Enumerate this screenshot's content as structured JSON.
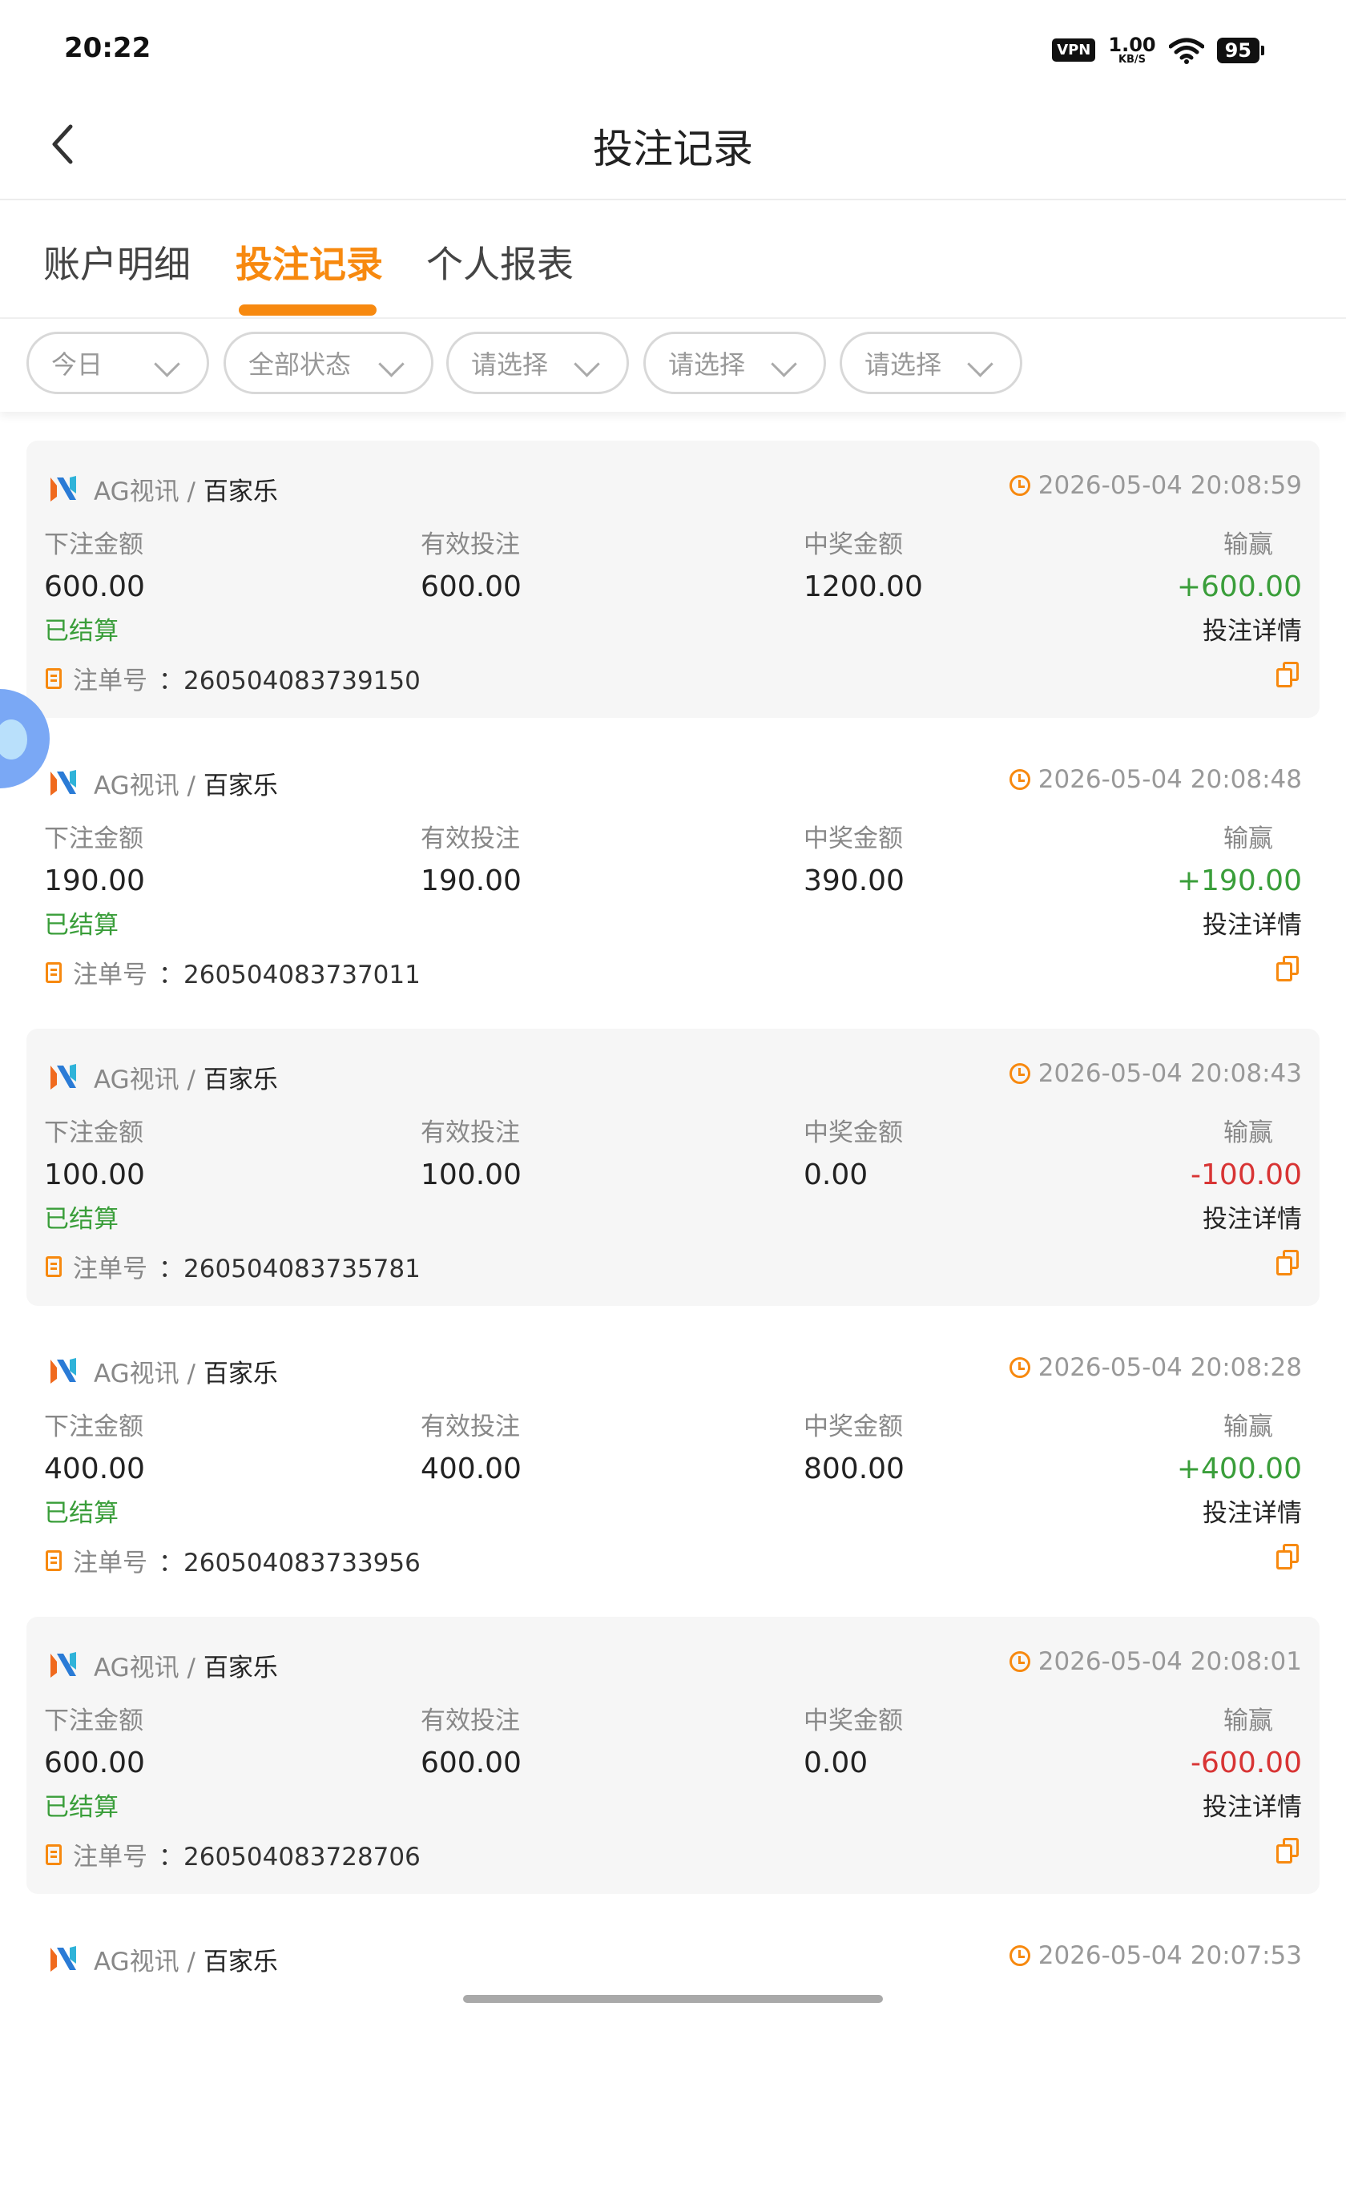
{
  "status_bar": {
    "time": "20:22",
    "vpn": "VPN",
    "speed_value": "1.00",
    "speed_unit": "KB/S",
    "battery": "95"
  },
  "header": {
    "title": "投注记录",
    "back_icon": "chevron-left-icon"
  },
  "tabs": [
    {
      "label": "账户明细",
      "active": false
    },
    {
      "label": "投注记录",
      "active": true
    },
    {
      "label": "个人报表",
      "active": false
    }
  ],
  "filters": [
    {
      "label": "今日"
    },
    {
      "label": "全部状态"
    },
    {
      "label": "请选择"
    },
    {
      "label": "请选择"
    },
    {
      "label": "请选择"
    }
  ],
  "labels": {
    "bet_amount": "下注金额",
    "valid_bet": "有效投注",
    "win_amount": "中奖金额",
    "win_loss": "输赢",
    "detail": "投注详情",
    "order_no": "注单号",
    "order_sep": "："
  },
  "colors": {
    "accent": "#f7890f",
    "positive": "#3a9e3a",
    "negative": "#d83434"
  },
  "records": [
    {
      "provider": "AG视讯",
      "sep": " / ",
      "game": "百家乐",
      "time": "2026-05-04 20:08:59",
      "bet": "600.00",
      "valid": "600.00",
      "win": "1200.00",
      "profit": "+600.00",
      "profit_sign": "pos",
      "status": "已结算",
      "order": "260504083739150"
    },
    {
      "provider": "AG视讯",
      "sep": " / ",
      "game": "百家乐",
      "time": "2026-05-04 20:08:48",
      "bet": "190.00",
      "valid": "190.00",
      "win": "390.00",
      "profit": "+190.00",
      "profit_sign": "pos",
      "status": "已结算",
      "order": "260504083737011"
    },
    {
      "provider": "AG视讯",
      "sep": " / ",
      "game": "百家乐",
      "time": "2026-05-04 20:08:43",
      "bet": "100.00",
      "valid": "100.00",
      "win": "0.00",
      "profit": "-100.00",
      "profit_sign": "neg",
      "status": "已结算",
      "order": "260504083735781"
    },
    {
      "provider": "AG视讯",
      "sep": " / ",
      "game": "百家乐",
      "time": "2026-05-04 20:08:28",
      "bet": "400.00",
      "valid": "400.00",
      "win": "800.00",
      "profit": "+400.00",
      "profit_sign": "pos",
      "status": "已结算",
      "order": "260504083733956"
    },
    {
      "provider": "AG视讯",
      "sep": " / ",
      "game": "百家乐",
      "time": "2026-05-04 20:08:01",
      "bet": "600.00",
      "valid": "600.00",
      "win": "0.00",
      "profit": "-600.00",
      "profit_sign": "neg",
      "status": "已结算",
      "order": "260504083728706"
    },
    {
      "provider": "AG视讯",
      "sep": " / ",
      "game": "百家乐",
      "time": "2026-05-04 20:07:53"
    }
  ]
}
